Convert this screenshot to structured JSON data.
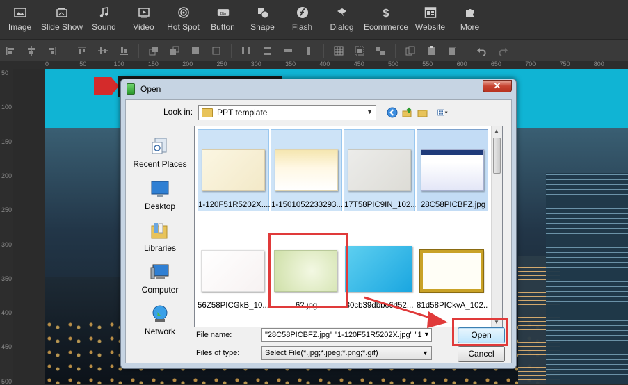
{
  "toolbar": {
    "items": [
      {
        "label": "Image",
        "icon": "image-icon"
      },
      {
        "label": "Slide Show",
        "icon": "slideshow-icon"
      },
      {
        "label": "Sound",
        "icon": "music-note-icon"
      },
      {
        "label": "Video",
        "icon": "video-play-icon"
      },
      {
        "label": "Hot Spot",
        "icon": "target-icon"
      },
      {
        "label": "Button",
        "icon": "button-icon"
      },
      {
        "label": "Shape",
        "icon": "shape-icon"
      },
      {
        "label": "Flash",
        "icon": "flash-icon"
      },
      {
        "label": "Dialog",
        "icon": "dialog-icon"
      },
      {
        "label": "Ecommerce",
        "icon": "dollar-icon"
      },
      {
        "label": "Website",
        "icon": "website-icon"
      },
      {
        "label": "More",
        "icon": "puzzle-icon"
      }
    ]
  },
  "ruler": {
    "top_ticks": [
      "0",
      "50",
      "100",
      "150",
      "200",
      "250",
      "300",
      "350",
      "400",
      "450",
      "500",
      "550",
      "600",
      "650",
      "700",
      "750",
      "800"
    ],
    "left_ticks": [
      "50",
      "100",
      "150",
      "200",
      "250",
      "300",
      "350",
      "400",
      "450",
      "500"
    ]
  },
  "dialog": {
    "title": "Open",
    "close_label": "✕",
    "look_in_label": "Look in:",
    "look_in_value": "PPT template",
    "places": [
      {
        "label": "Recent Places",
        "icon": "recent-places-icon"
      },
      {
        "label": "Desktop",
        "icon": "desktop-icon"
      },
      {
        "label": "Libraries",
        "icon": "libraries-icon"
      },
      {
        "label": "Computer",
        "icon": "computer-icon"
      },
      {
        "label": "Network",
        "icon": "network-icon"
      }
    ],
    "files": [
      {
        "name": "1-120F51R5202X....",
        "selected": true
      },
      {
        "name": "1-1501052233293...",
        "selected": true
      },
      {
        "name": "17T58PIC9IN_102...",
        "selected": true
      },
      {
        "name": "28C58PICBFZ.jpg",
        "selected": true
      },
      {
        "name": "56Z58PICGkB_10...",
        "selected": false
      },
      {
        "name": "62.jpg",
        "selected": false
      },
      {
        "name": "80cb39dbbc6d52...",
        "selected": false
      },
      {
        "name": "81d58PICkvA_102...",
        "selected": false
      }
    ],
    "file_name_label": "File name:",
    "file_name_value": "\"28C58PICBFZ.jpg\" \"1-120F51R5202X.jpg\" \"1",
    "file_type_label": "Files of type:",
    "file_type_value": "Select File(*.jpg;*.jpeg;*.png;*.gif)",
    "open_label": "Open",
    "cancel_label": "Cancel"
  },
  "colors": {
    "toolbar_bg": "#333333",
    "canvas_bg": "#10b4d4",
    "highlight_red": "#e03a3a",
    "dialog_frame": "#c6d4e3"
  }
}
